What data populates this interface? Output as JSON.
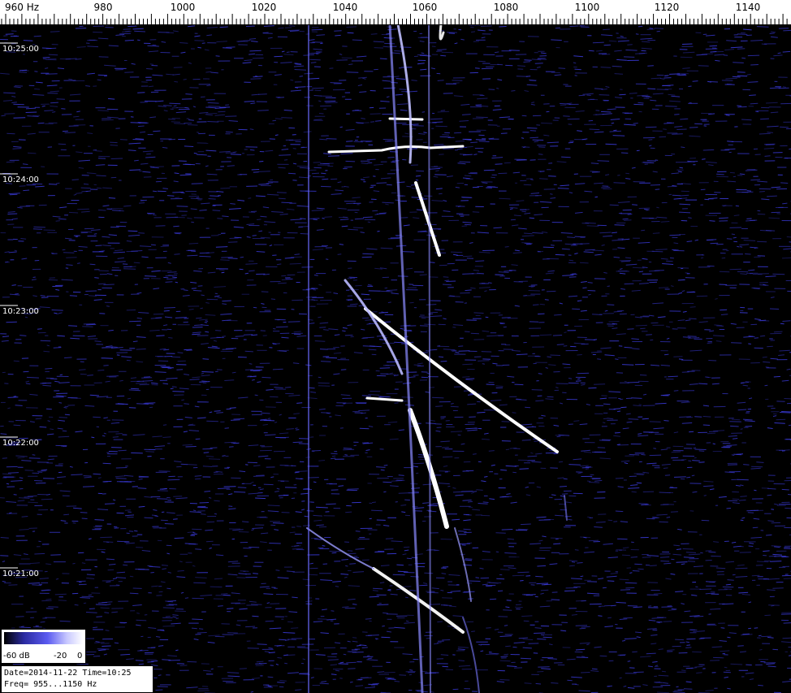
{
  "frequency_axis": {
    "unit": "Hz",
    "ticks": [
      "960 Hz",
      "980",
      "1000",
      "1020",
      "1040",
      "1060",
      "1080",
      "1100",
      "1120",
      "1140"
    ]
  },
  "time_axis": {
    "labels": [
      "10:25:00",
      "10:24:00",
      "10:23:00",
      "10:22:00",
      "10:21:00"
    ]
  },
  "scale": {
    "min_label": "-60 dB",
    "mid_label": "-20",
    "max_label": "0"
  },
  "info": {
    "date_time": "Date=2014-11-22 Time=10:25",
    "freq_range": "Freq= 955...1150 Hz"
  },
  "colors": {
    "background": "#000000",
    "noise": "#3a3ad8",
    "signal": "#ffffff"
  }
}
